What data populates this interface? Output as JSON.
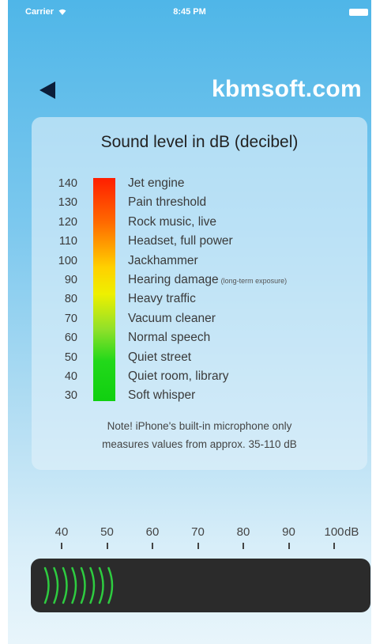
{
  "status_bar": {
    "carrier": "Carrier",
    "time": "8:45 PM"
  },
  "nav": {
    "back_icon": "back-triangle-icon",
    "title": "kbmsoft.com"
  },
  "card": {
    "title": "Sound level in dB (decibel)",
    "levels": [
      {
        "db": "140",
        "label": "Jet engine"
      },
      {
        "db": "130",
        "label": "Pain threshold"
      },
      {
        "db": "120",
        "label": "Rock music, live"
      },
      {
        "db": "110",
        "label": "Headset, full power"
      },
      {
        "db": "100",
        "label": "Jackhammer"
      },
      {
        "db": "90",
        "label": "Hearing damage",
        "note": "(long-term exposure)"
      },
      {
        "db": "80",
        "label": "Heavy traffic"
      },
      {
        "db": "70",
        "label": "Vacuum cleaner"
      },
      {
        "db": "60",
        "label": "Normal speech"
      },
      {
        "db": "50",
        "label": "Quiet street"
      },
      {
        "db": "40",
        "label": "Quiet room, library"
      },
      {
        "db": "30",
        "label": "Soft whisper"
      }
    ],
    "note_line1": "Note! iPhone's built-in microphone only",
    "note_line2": "measures values from approx. 35-110 dB"
  },
  "meter": {
    "ticks": [
      "40",
      "50",
      "60",
      "70",
      "80",
      "90",
      "100"
    ],
    "unit": "dB",
    "bar_count": 8,
    "bar_color": "#2ecc40",
    "level_db": 46
  },
  "colors": {
    "background_top": "#4fb6e8",
    "meter_panel": "#2b2b2b",
    "scale_hot": "#ff1e00",
    "scale_mid": "#eef000",
    "scale_cool": "#10d010"
  }
}
